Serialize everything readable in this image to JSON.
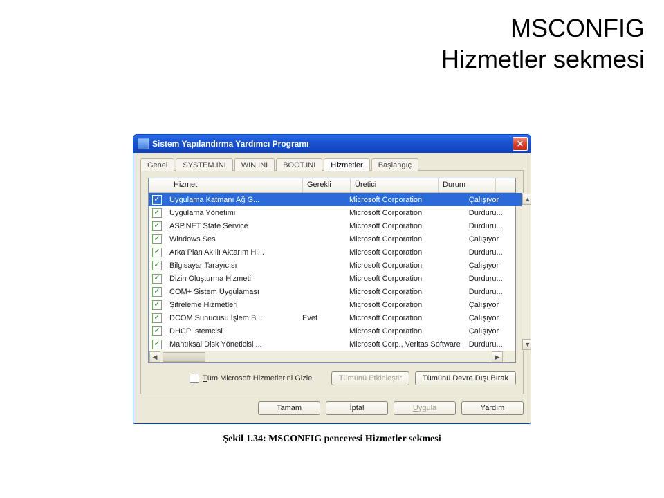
{
  "heading_line1": "MSCONFIG",
  "heading_line2": "Hizmetler sekmesi",
  "caption_text": "Şekil 1.34: MSCONFIG penceresi Hizmetler sekmesi",
  "window": {
    "title": "Sistem Yapılandırma Yardımcı Programı",
    "tabs": [
      "Genel",
      "SYSTEM.INI",
      "WIN.INI",
      "BOOT.INI",
      "Hizmetler",
      "Başlangıç"
    ],
    "active_tab_index": 4,
    "columns": {
      "service": "Hizmet",
      "required": "Gerekli",
      "manufacturer": "Üretici",
      "state": "Durum"
    },
    "rows": [
      {
        "checked": true,
        "selected": true,
        "service": "Uygulama Katmanı Ağ G...",
        "required": "",
        "manufacturer": "Microsoft Corporation",
        "state": "Çalışıyor"
      },
      {
        "checked": true,
        "selected": false,
        "service": "Uygulama Yönetimi",
        "required": "",
        "manufacturer": "Microsoft Corporation",
        "state": "Durduru..."
      },
      {
        "checked": true,
        "selected": false,
        "service": "ASP.NET State Service",
        "required": "",
        "manufacturer": "Microsoft Corporation",
        "state": "Durduru..."
      },
      {
        "checked": true,
        "selected": false,
        "service": "Windows Ses",
        "required": "",
        "manufacturer": "Microsoft Corporation",
        "state": "Çalışıyor"
      },
      {
        "checked": true,
        "selected": false,
        "service": "Arka Plan Akıllı Aktarım Hi...",
        "required": "",
        "manufacturer": "Microsoft Corporation",
        "state": "Durduru..."
      },
      {
        "checked": true,
        "selected": false,
        "service": "Bilgisayar Tarayıcısı",
        "required": "",
        "manufacturer": "Microsoft Corporation",
        "state": "Çalışıyor"
      },
      {
        "checked": true,
        "selected": false,
        "service": "Dizin Oluşturma Hizmeti",
        "required": "",
        "manufacturer": "Microsoft Corporation",
        "state": "Durduru..."
      },
      {
        "checked": true,
        "selected": false,
        "service": "COM+ Sistem Uygulaması",
        "required": "",
        "manufacturer": "Microsoft Corporation",
        "state": "Durduru..."
      },
      {
        "checked": true,
        "selected": false,
        "service": "Şifreleme Hizmetleri",
        "required": "",
        "manufacturer": "Microsoft Corporation",
        "state": "Çalışıyor"
      },
      {
        "checked": true,
        "selected": false,
        "service": "DCOM Sunucusu İşlem B...",
        "required": "Evet",
        "manufacturer": "Microsoft Corporation",
        "state": "Çalışıyor"
      },
      {
        "checked": true,
        "selected": false,
        "service": "DHCP İstemcisi",
        "required": "",
        "manufacturer": "Microsoft Corporation",
        "state": "Çalışıyor"
      },
      {
        "checked": true,
        "selected": false,
        "service": "Mantıksal Disk Yöneticisi ...",
        "required": "",
        "manufacturer": "Microsoft Corp., Veritas Software",
        "state": "Durduru..."
      }
    ],
    "hide_ms_prefix": "T",
    "hide_ms_label": "üm Microsoft Hizmetlerini Gizle",
    "btn_enable_all": "Tümünü Etkinleştir",
    "btn_disable_all": "Tümünü Devre Dışı Bırak",
    "btn_ok": "Tamam",
    "btn_cancel": "İptal",
    "btn_apply_prefix": "U",
    "btn_apply_label": "ygula",
    "btn_help": "Yardım"
  }
}
